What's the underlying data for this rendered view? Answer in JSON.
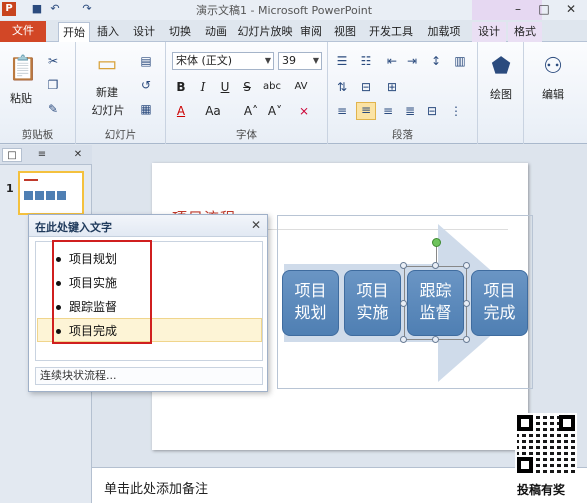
{
  "window": {
    "title": "演示文稿1 - Microsoft PowerPoint",
    "app_icon": "P",
    "qa_save": "■",
    "qa_undo": "↶",
    "qa_redo": "↷",
    "min": "–",
    "max": "□",
    "close": "✕"
  },
  "tabs": [
    "文件",
    "开始",
    "插入",
    "设计",
    "切换",
    "动画",
    "幻灯片放映",
    "审阅",
    "视图",
    "开发工具",
    "加载项",
    "设计",
    "格式"
  ],
  "ribbon": {
    "clipboard": {
      "label": "剪贴板",
      "paste": "粘贴",
      "paste_icon": "📋",
      "cut_icon": "✂",
      "copy_icon": "❐",
      "brush_icon": "✎"
    },
    "slides": {
      "label": "幻灯片",
      "new_slide": "新建",
      "new_slide2": "幻灯片",
      "layout_icon": "▤",
      "reset_icon": "↺",
      "section_icon": "▦"
    },
    "font": {
      "label": "字体",
      "font_name": "宋体 (正文)",
      "font_size": "39",
      "bold": "B",
      "italic": "I",
      "underline": "U",
      "strike": "S",
      "shadow": "abc",
      "spacing": "AV",
      "color": "A",
      "case": "Aa",
      "grow": "A˄",
      "shrink": "A˅",
      "clear": "⨯"
    },
    "paragraph": {
      "label": "段落"
    },
    "drawing": {
      "label": "绘图",
      "icon": "⬟"
    },
    "editing": {
      "label": "编辑",
      "icon": "⚇"
    }
  },
  "panes": {
    "tab1_icon": "□",
    "tab2_icon": "≡",
    "close": "✕"
  },
  "thumbnail": {
    "number": "1"
  },
  "slide": {
    "title": "项目流程"
  },
  "smartart": {
    "shapes": [
      {
        "line1": "项目",
        "line2": "规划"
      },
      {
        "line1": "项目",
        "line2": "实施"
      },
      {
        "line1": "跟踪",
        "line2": "监督"
      },
      {
        "line1": "项目",
        "line2": "完成"
      }
    ]
  },
  "text_pane": {
    "title": "在此处键入文字",
    "close": "✕",
    "items": [
      "项目规划",
      "项目实施",
      "跟踪监督",
      "项目完成"
    ],
    "footer": "连续块状流程..."
  },
  "notes": {
    "placeholder": "单击此处添加备注"
  },
  "overlay": {
    "qr_label": "投稿有奖"
  },
  "colors": {
    "file_tab": "#d24726",
    "shape_fill": "#4f7fb3",
    "highlight_border": "#d01f1f"
  }
}
